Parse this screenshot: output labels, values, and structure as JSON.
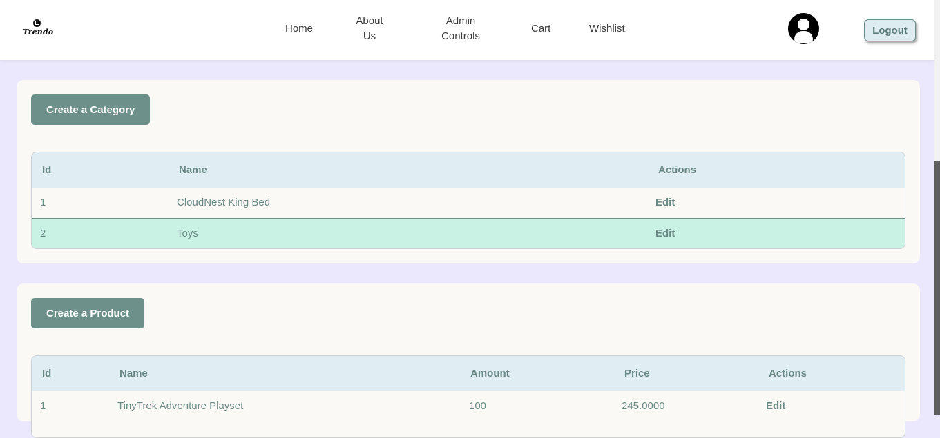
{
  "brand": {
    "logo_text": "Trendo"
  },
  "nav": {
    "home": "Home",
    "about_line1": "About",
    "about_line2": "Us",
    "admin_line1": "Admin",
    "admin_line2": "Controls",
    "cart": "Cart",
    "wishlist": "Wishlist",
    "logout": "Logout"
  },
  "categories": {
    "create_label": "Create a Category",
    "headers": {
      "id": "Id",
      "name": "Name",
      "actions": "Actions"
    },
    "rows": [
      {
        "id": "1",
        "name": "CloudNest King Bed",
        "action": "Edit"
      },
      {
        "id": "2",
        "name": "Toys",
        "action": "Edit"
      }
    ]
  },
  "products": {
    "create_label": "Create a Product",
    "headers": {
      "id": "Id",
      "name": "Name",
      "amount": "Amount",
      "price": "Price",
      "actions": "Actions"
    },
    "rows": [
      {
        "id": "1",
        "name": "TinyTrek Adventure Playset",
        "amount": "100",
        "price": "245.0000",
        "action": "Edit"
      }
    ]
  },
  "colors": {
    "page_bg": "#ebe7fc",
    "accent": "#6e908b",
    "highlight_row": "#c9f1e4",
    "table_header_bg": "#e0eef4"
  }
}
